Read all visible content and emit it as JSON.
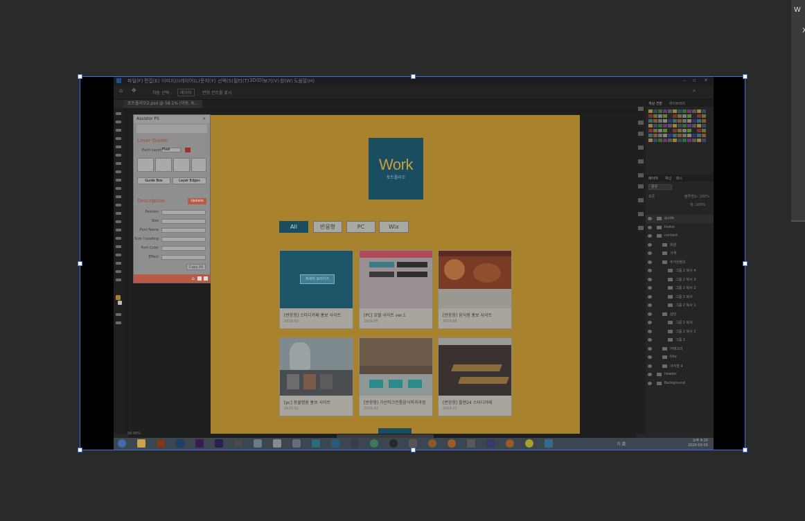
{
  "edge_panel": {
    "top_text": "W",
    "close_text": "X"
  },
  "menu": [
    "파일(F)",
    "편집(E)",
    "이미지(I)",
    "레이어(L)",
    "문자(Y)",
    "선택(S)",
    "필터(T)",
    "3D(D)",
    "보기(V)",
    "창(W)",
    "도움말(H)"
  ],
  "options_bar": {
    "auto_select": "자동 선택 :",
    "layer_dropdown": "레이어",
    "transform_controls": "변형 컨트롤 표시"
  },
  "document_tab": {
    "label": "포트폴리오2.psd @ 58.1% (이동, R..."
  },
  "assistor": {
    "title": "Assistor PS",
    "layer_guider": "Layer Guider",
    "each_layer": "Each Layer",
    "unit": "Pixel",
    "guide_box": "Guide Box",
    "layer_edges": "Layer Edges",
    "description": "Description",
    "update": "Update",
    "fields": [
      "Position",
      "Size",
      "Font Name",
      "Size / Leading",
      "Font Color",
      "Effect"
    ],
    "copy_all": "Copy All"
  },
  "page": {
    "logo_title": "Work",
    "logo_subtitle": "포트폴리오",
    "filters": [
      "All",
      "반응형",
      "PC",
      "Wix"
    ],
    "cards": [
      {
        "title": "[반응형] 스타디카페 홍보 사이트",
        "date": "2019.03"
      },
      {
        "title": "[PC] 호텔 사이트 ver.1",
        "date": "2019.05"
      },
      {
        "title": "[반응형] 음식점 홍보 사이트",
        "date": "2019.06"
      },
      {
        "title": "[pc] 동물병원 홍보 사이트",
        "date": "2019.02"
      },
      {
        "title": "[반응형] 가산타크전통음식학과과정",
        "date": "2019.03"
      },
      {
        "title": "[반응형] 플랜24 스터디카페",
        "date": "2019.01"
      }
    ],
    "card_overlay_button": "자세히 보러가기"
  },
  "status": {
    "zoom": "58.08%"
  },
  "right_panel": {
    "swatch_tabs": [
      "색상 견본",
      "라이브러리"
    ],
    "layer_tabs": [
      "레이어",
      "채널",
      "패스"
    ],
    "kind_filter": "종류",
    "blend_mode": "표준",
    "opacity": "불투명도: 100%",
    "fill": "칠: 100%",
    "layers": [
      {
        "name": "guide",
        "depth": 0
      },
      {
        "name": "footer",
        "depth": 0
      },
      {
        "name": "content",
        "depth": 0
      },
      {
        "name": "회원",
        "depth": 1
      },
      {
        "name": "가격",
        "depth": 1
      },
      {
        "name": "추가컨텐츠",
        "depth": 1
      },
      {
        "name": "그룹 2 복사 4",
        "depth": 2
      },
      {
        "name": "그룹 2 복사 3",
        "depth": 2
      },
      {
        "name": "그룹 2 복사 2",
        "depth": 2
      },
      {
        "name": "그룹 2 복사",
        "depth": 2
      },
      {
        "name": "그룹 2 복사 1",
        "depth": 2
      },
      {
        "name": "상단",
        "depth": 1
      },
      {
        "name": "그룹 2 복사",
        "depth": 2
      },
      {
        "name": "그룹 2 복사 2",
        "depth": 2
      },
      {
        "name": "그룹 2",
        "depth": 2
      },
      {
        "name": "카테고리",
        "depth": 1
      },
      {
        "name": "title",
        "depth": 1
      },
      {
        "name": "사각형 4",
        "depth": 1
      },
      {
        "name": "header",
        "depth": 0
      },
      {
        "name": "Background",
        "depth": 0
      }
    ]
  },
  "taskbar": {
    "clock_time": "오후 4:15",
    "clock_date": "2020-03-05",
    "ime": "가 英"
  },
  "colors": {
    "artboard": "#a8822c",
    "accent": "#1b4d61",
    "selection": "#3f6fe0"
  }
}
